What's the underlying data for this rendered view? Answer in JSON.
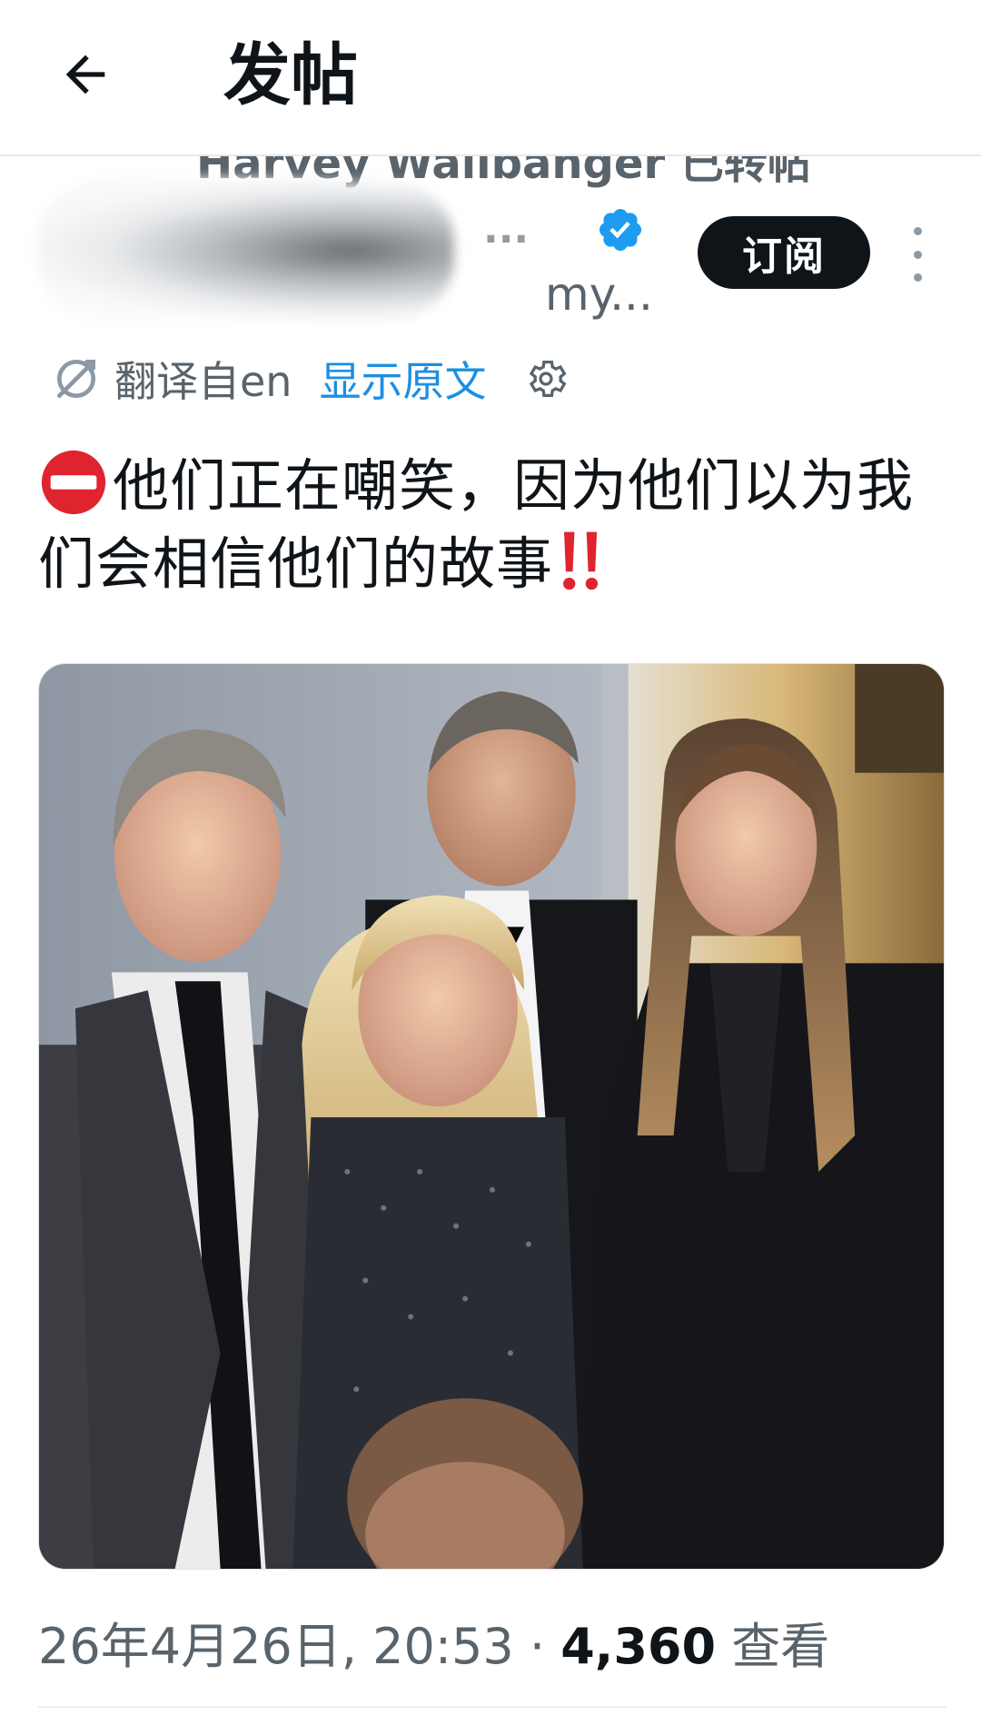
{
  "header": {
    "title": "发帖"
  },
  "retweet": {
    "text": "Harvey Wallbanger 已转帖"
  },
  "author": {
    "name_fragment": "...",
    "handle_fragment": "my..."
  },
  "actions": {
    "subscribe_label": "订阅"
  },
  "translation": {
    "label": "翻译自en",
    "show_original": "显示原文"
  },
  "post": {
    "text": "他们正在嘲笑，因为他们以为我们会相信他们的故事"
  },
  "meta": {
    "datetime": "26年4月26日, 20:53",
    "separator": " · ",
    "views_count": "4,360",
    "views_label": " 查看"
  },
  "colors": {
    "accent_blue": "#1d8fe0",
    "secondary_text": "#59636b",
    "primary_text": "#0f1419",
    "no_entry_red": "#e0242f"
  },
  "icons": {
    "back": "arrow-left-icon",
    "verified": "verified-badge-icon",
    "more": "more-vertical-icon",
    "translate": "translate-icon",
    "settings": "gear-icon",
    "no_entry": "no-entry-emoji",
    "double_exclamation": "double-exclamation-emoji"
  }
}
